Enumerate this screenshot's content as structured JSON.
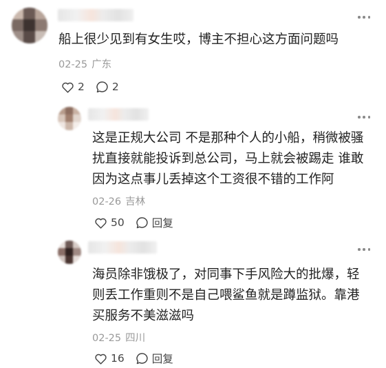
{
  "comments": [
    {
      "id": "c1",
      "text_lines": [
        "船上很少见到有女生哎，博主不担心这方面问题吗"
      ],
      "date": "02-25",
      "location": "广东",
      "likes": "2",
      "replies": "2"
    },
    {
      "id": "c2",
      "text_lines": [
        "这是正规大公司 不是那种个人的小船，稍微被骚",
        "扰直接就能投诉到总公司，马上就会被踢走 谁敢",
        "因为这点事儿丢掉这个工资很不错的工作阿"
      ],
      "date": "02-26",
      "location": "吉林",
      "likes": "50",
      "reply_label": "回复"
    },
    {
      "id": "c3",
      "text_lines": [
        "海员除非饿极了，对同事下手风险大的批爆，轻",
        "则丢工作重则不是自己喂鲨鱼就是蹲监狱。靠港",
        "买服务不美滋滋吗"
      ],
      "date": "02-25",
      "location": "四川",
      "likes": "16",
      "reply_label": "回复"
    }
  ],
  "icons": {
    "like": "heart-outline-icon",
    "comment": "speech-bubble-icon",
    "more": "more-dots-icon"
  },
  "colors": {
    "text": "#222222",
    "meta": "#999999",
    "icon": "#444444"
  }
}
